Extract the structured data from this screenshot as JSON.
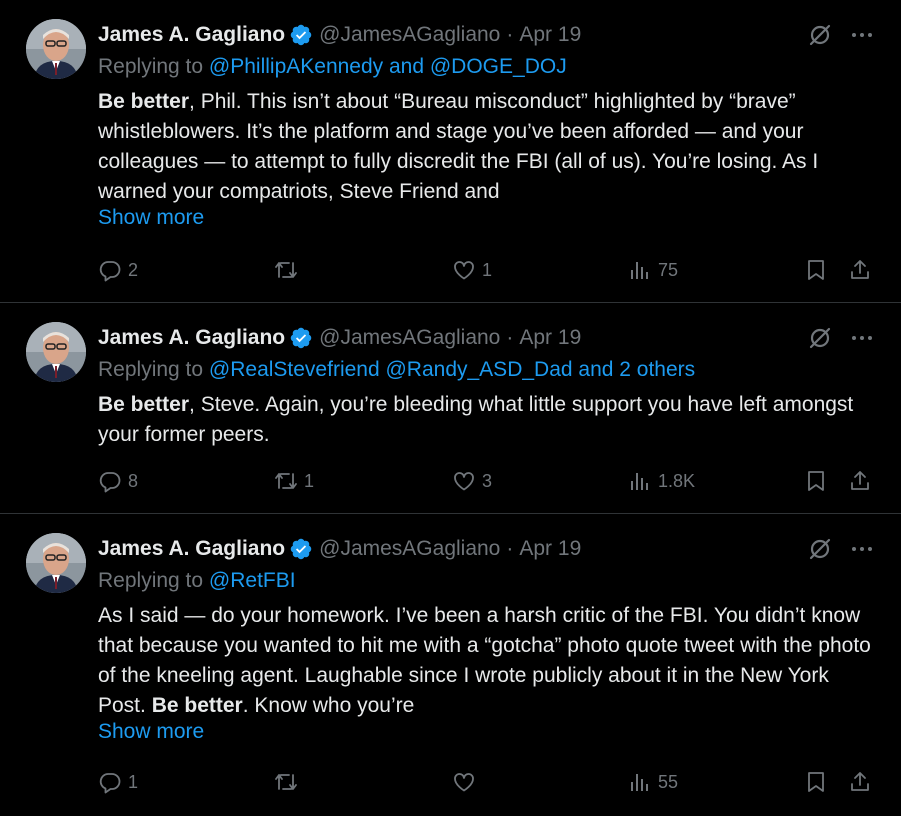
{
  "tweets": [
    {
      "name": "James A. Gagliano",
      "handle": "@JamesAGagliano",
      "sep": "·",
      "date": "Apr 19",
      "replying_prefix": "Replying to ",
      "replying_to": "@PhillipAKennedy and @DOGE_DOJ",
      "body_bold": "Be better",
      "body_rest": ", Phil. This isn’t about “Bureau misconduct” highlighted by “brave” whistleblowers. It’s the platform and stage you’ve been afforded — and your colleagues — to attempt to fully discredit the FBI (all of us). You’re losing. As I warned your compatriots, Steve Friend and",
      "show_more": "Show more",
      "replies": "2",
      "reposts": "",
      "likes": "1",
      "views": "75"
    },
    {
      "name": "James A. Gagliano",
      "handle": "@JamesAGagliano",
      "sep": "·",
      "date": "Apr 19",
      "replying_prefix": "Replying to ",
      "replying_to": "@RealStevefriend @Randy_ASD_Dad and 2 others",
      "body_bold": "Be better",
      "body_rest": ", Steve. Again, you’re bleeding what little support you have left amongst your former peers.",
      "replies": "8",
      "reposts": "1",
      "likes": "3",
      "views": "1.8K"
    },
    {
      "name": "James A. Gagliano",
      "handle": "@JamesAGagliano",
      "sep": "·",
      "date": "Apr 19",
      "replying_prefix": "Replying to ",
      "replying_to": "@RetFBI",
      "body_pre": "As I said — do your homework. I’ve been a harsh critic of the FBI. You didn’t know that because you wanted to hit me with a “gotcha” photo quote tweet with the photo of the kneeling agent. Laughable since I wrote publicly about it in the New York Post. ",
      "body_bold": "Be better",
      "body_post": ". Know who you’re",
      "show_more": "Show more",
      "replies": "1",
      "reposts": "",
      "likes": "",
      "views": "55"
    }
  ],
  "colors": {
    "background": "#000000",
    "text": "#e7e9ea",
    "muted": "#71767b",
    "accent": "#1d9bf0",
    "divider": "#2f3336"
  },
  "icons": [
    "verified-badge-icon",
    "grok-icon",
    "more-icon",
    "reply-icon",
    "repost-icon",
    "like-icon",
    "views-icon",
    "bookmark-icon",
    "share-icon"
  ]
}
